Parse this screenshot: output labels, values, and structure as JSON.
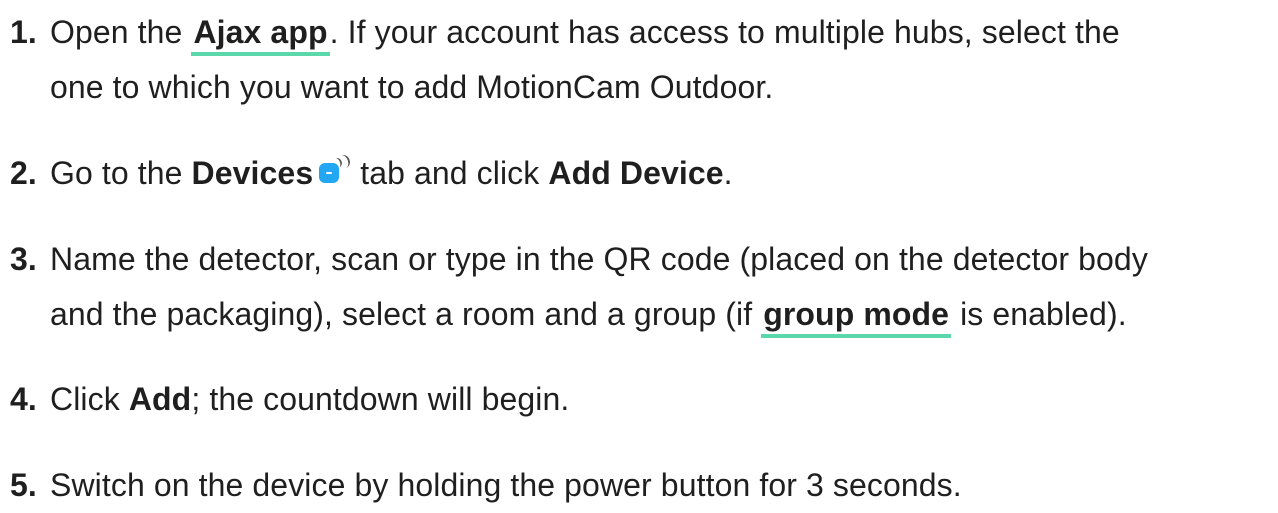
{
  "steps": [
    {
      "number": "1.",
      "pre": "Open the ",
      "link": "Ajax app",
      "post": ". If your account has access to multiple hubs, select the",
      "line2": "one to which you want to add MotionCam Outdoor."
    },
    {
      "number": "2.",
      "pre": "Go to the ",
      "bold1": "Devices",
      "icon": "devices-icon",
      "mid": " tab and click ",
      "bold2": "Add Device",
      "post": "."
    },
    {
      "number": "3.",
      "line1": "Name the detector, scan or type in the QR code (placed on the detector body",
      "line2_pre": "and the packaging), select a room and a group (if ",
      "link": "group mode",
      "line2_post": " is enabled)."
    },
    {
      "number": "4.",
      "pre": "Click ",
      "bold": "Add",
      "post": "; the countdown will begin."
    },
    {
      "number": "5.",
      "text": "Switch on the device by holding the power button for 3 seconds."
    }
  ],
  "colors": {
    "text": "#1f1f1f",
    "link_underline": "#5ad7ab",
    "icon_blue": "#24a7f2"
  }
}
